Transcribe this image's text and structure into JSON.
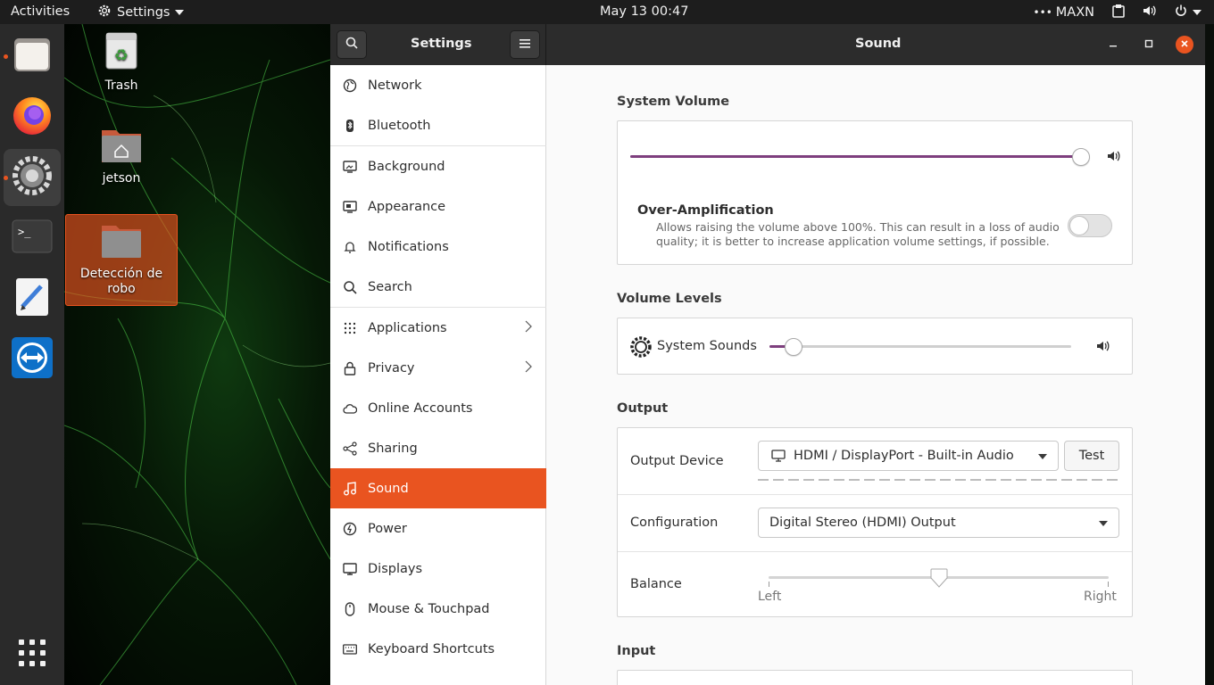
{
  "topbar": {
    "activities": "Activities",
    "app_menu": "Settings",
    "clock": "May 13  00:47",
    "power_mode": "MAXN"
  },
  "desktop": {
    "icons": [
      {
        "label": "Trash",
        "icon": "trash-icon"
      },
      {
        "label": "jetson",
        "icon": "home-folder-icon"
      },
      {
        "label": "Detección de robo",
        "icon": "folder-icon"
      }
    ]
  },
  "dock": {
    "apps": [
      "files-icon",
      "firefox-icon",
      "settings-icon",
      "terminal-icon",
      "text-editor-icon",
      "teamviewer-icon",
      "show-apps-icon"
    ]
  },
  "window": {
    "sidebar_title": "Settings",
    "page_title": "Sound"
  },
  "sidebar": {
    "items": [
      {
        "label": "Network",
        "icon": "network-icon"
      },
      {
        "label": "Bluetooth",
        "icon": "bluetooth-icon"
      },
      {
        "label": "Background",
        "icon": "background-icon"
      },
      {
        "label": "Appearance",
        "icon": "appearance-icon"
      },
      {
        "label": "Notifications",
        "icon": "bell-icon"
      },
      {
        "label": "Search",
        "icon": "search-icon"
      },
      {
        "label": "Applications",
        "icon": "grid-icon"
      },
      {
        "label": "Privacy",
        "icon": "lock-icon"
      },
      {
        "label": "Online Accounts",
        "icon": "cloud-icon"
      },
      {
        "label": "Sharing",
        "icon": "share-icon"
      },
      {
        "label": "Sound",
        "icon": "music-note-icon"
      },
      {
        "label": "Power",
        "icon": "power-icon"
      },
      {
        "label": "Displays",
        "icon": "display-icon"
      },
      {
        "label": "Mouse & Touchpad",
        "icon": "mouse-icon"
      },
      {
        "label": "Keyboard Shortcuts",
        "icon": "keyboard-icon"
      }
    ],
    "selected": "Sound"
  },
  "sound": {
    "system_volume_title": "System Volume",
    "system_volume_level": 1.0,
    "over_amp_title": "Over-Amplification",
    "over_amp_desc_1": "Allows raising the volume above 100%. This can result in a loss of audio",
    "over_amp_desc_2": "quality; it is better to increase application volume settings, if possible.",
    "over_amp_enabled": false,
    "volume_levels_title": "Volume Levels",
    "system_sounds_label": "System Sounds",
    "system_sounds_level": 0.05,
    "output_title": "Output",
    "output_device_label": "Output Device",
    "output_device_value": "HDMI / DisplayPort - Built-in Audio",
    "test_label": "Test",
    "configuration_label": "Configuration",
    "configuration_value": "Digital Stereo (HDMI) Output",
    "balance_label": "Balance",
    "balance_value": 0.5,
    "balance_left": "Left",
    "balance_right": "Right",
    "input_title": "Input"
  },
  "colors": {
    "accent": "#e95420",
    "slider_fill": "#7e3f7e",
    "header": "#2c2c2c"
  }
}
